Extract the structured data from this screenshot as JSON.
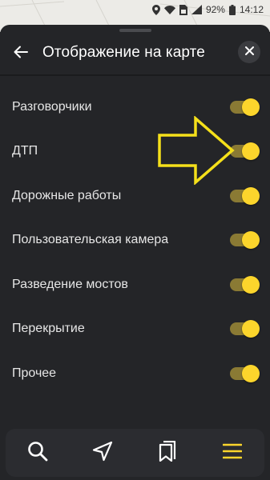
{
  "status_bar": {
    "battery_percent": "92%",
    "time": "14:12",
    "icons": [
      "location-icon",
      "wifi-icon",
      "sim-icon",
      "signal-icon",
      "battery-icon"
    ]
  },
  "header": {
    "title": "Отображение на карте",
    "back_icon": "arrow-left-icon",
    "close_icon": "close-icon"
  },
  "settings": [
    {
      "label": "Разговорчики",
      "enabled": true
    },
    {
      "label": "ДТП",
      "enabled": true
    },
    {
      "label": "Дорожные работы",
      "enabled": true
    },
    {
      "label": "Пользовательская камера",
      "enabled": true
    },
    {
      "label": "Разведение мостов",
      "enabled": true
    },
    {
      "label": "Перекрытие",
      "enabled": true
    },
    {
      "label": "Прочее",
      "enabled": true
    }
  ],
  "bottom_nav": {
    "items": [
      "search-icon",
      "navigation-arrow-icon",
      "bookmarks-icon",
      "menu-icon"
    ],
    "active": "menu-icon"
  },
  "colors": {
    "accent": "#fcd52c",
    "toggle_track": "#8a7a34",
    "sheet_background": "#242528",
    "annotation": "#f5e01a"
  }
}
